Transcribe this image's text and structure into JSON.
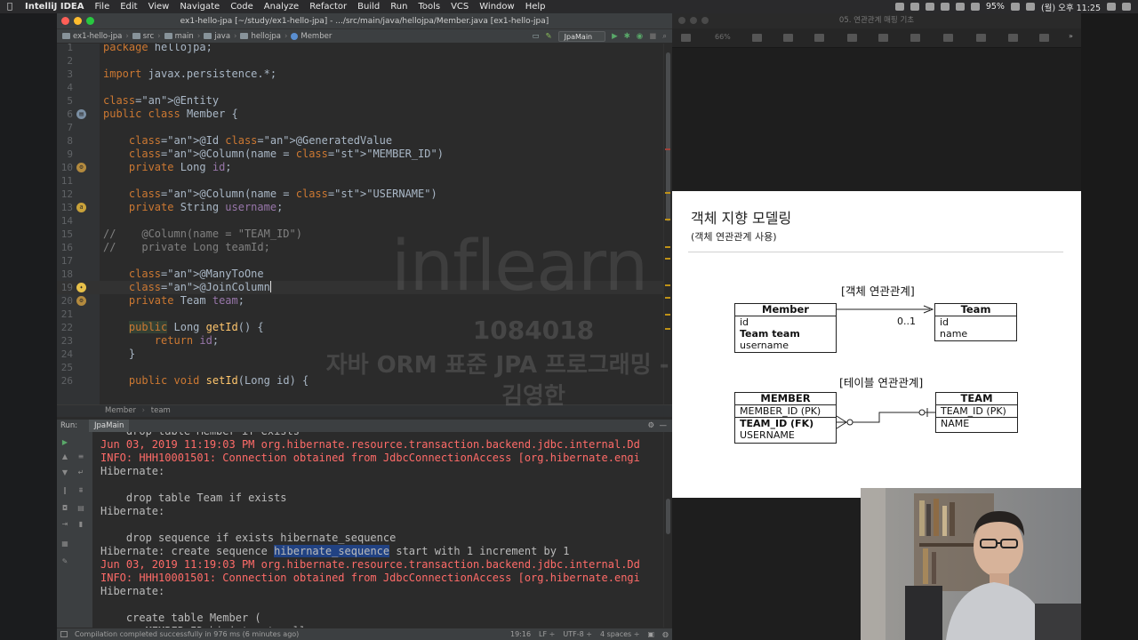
{
  "menubar": {
    "app_name": "IntelliJ IDEA",
    "menus": [
      "File",
      "Edit",
      "View",
      "Navigate",
      "Code",
      "Analyze",
      "Refactor",
      "Build",
      "Run",
      "Tools",
      "VCS",
      "Window",
      "Help"
    ],
    "battery": "95%",
    "clock": "(월) 오후 11:25"
  },
  "ide": {
    "window_title": "ex1-hello-jpa [~/study/ex1-hello-jpa] - .../src/main/java/hellojpa/Member.java [ex1-hello-jpa]",
    "breadcrumbs": [
      "ex1-hello-jpa",
      "src",
      "main",
      "java",
      "hellojpa",
      "Member"
    ],
    "run_config": "JpaMain",
    "code_lines": [
      {
        "n": "1",
        "text": "package hellojpa;"
      },
      {
        "n": "2",
        "text": ""
      },
      {
        "n": "3",
        "text": "import javax.persistence.*;"
      },
      {
        "n": "4",
        "text": ""
      },
      {
        "n": "5",
        "text": "@Entity"
      },
      {
        "n": "6",
        "text": "public class Member {"
      },
      {
        "n": "7",
        "text": ""
      },
      {
        "n": "8",
        "text": "    @Id @GeneratedValue"
      },
      {
        "n": "9",
        "text": "    @Column(name = \"MEMBER_ID\")"
      },
      {
        "n": "10",
        "text": "    private Long id;"
      },
      {
        "n": "11",
        "text": ""
      },
      {
        "n": "12",
        "text": "    @Column(name = \"USERNAME\")"
      },
      {
        "n": "13",
        "text": "    private String username;"
      },
      {
        "n": "14",
        "text": ""
      },
      {
        "n": "15",
        "text": "//    @Column(name = \"TEAM_ID\")"
      },
      {
        "n": "16",
        "text": "//    private Long teamId;"
      },
      {
        "n": "17",
        "text": ""
      },
      {
        "n": "18",
        "text": "    @ManyToOne"
      },
      {
        "n": "19",
        "text": "    @JoinColumn"
      },
      {
        "n": "20",
        "text": "    private Team team;"
      },
      {
        "n": "21",
        "text": ""
      },
      {
        "n": "22",
        "text": "    public Long getId() {"
      },
      {
        "n": "23",
        "text": "        return id;"
      },
      {
        "n": "24",
        "text": "    }"
      },
      {
        "n": "25",
        "text": ""
      },
      {
        "n": "26",
        "text": "    public void setId(Long id) {"
      }
    ],
    "editor_crumbs": [
      "Member",
      "team"
    ],
    "run_label": "Run:",
    "run_tab": "JpaMain",
    "console_lines": [
      {
        "cls": "",
        "text": "    drop table Member if exists"
      },
      {
        "cls": "err",
        "text": "Jun 03, 2019 11:19:03 PM org.hibernate.resource.transaction.backend.jdbc.internal.Dd"
      },
      {
        "cls": "err",
        "text": "INFO: HHH10001501: Connection obtained from JdbcConnectionAccess [org.hibernate.engi"
      },
      {
        "cls": "",
        "text": "Hibernate:"
      },
      {
        "cls": "",
        "text": ""
      },
      {
        "cls": "",
        "text": "    drop table Team if exists"
      },
      {
        "cls": "",
        "text": "Hibernate:"
      },
      {
        "cls": "",
        "text": ""
      },
      {
        "cls": "",
        "text": "    drop sequence if exists hibernate_sequence"
      },
      {
        "cls": "",
        "text": "Hibernate: create sequence hibernate_sequence start with 1 increment by 1"
      },
      {
        "cls": "err",
        "text": "Jun 03, 2019 11:19:03 PM org.hibernate.resource.transaction.backend.jdbc.internal.Dd"
      },
      {
        "cls": "err",
        "text": "INFO: HHH10001501: Connection obtained from JdbcConnectionAccess [org.hibernate.engi"
      },
      {
        "cls": "",
        "text": "Hibernate:"
      },
      {
        "cls": "",
        "text": ""
      },
      {
        "cls": "",
        "text": "    create table Member ("
      },
      {
        "cls": "",
        "text": "       MEMBER_ID bigint not null,"
      }
    ],
    "status": {
      "message": "Compilation completed successfully in 976 ms (6 minutes ago)",
      "position": "19:16",
      "line_sep": "LF ÷",
      "encoding": "UTF-8 ÷",
      "indent": "4 spaces ÷"
    }
  },
  "watermark": {
    "logo": "inflearn",
    "id": "1084018",
    "course": "자바 ORM 표준 JPA 프로그래밍 - 기본편",
    "author": "김영한"
  },
  "keynote": {
    "window_title": "05. 연관관계 매핑 기초",
    "zoom": "66%",
    "slide": {
      "title": "객체 지향 모델링",
      "subtitle": "(객체 연관관계 사용)",
      "object_section": "[객체 연관관계]",
      "member_obj": {
        "header": "Member",
        "rows": [
          "id",
          "Team team",
          "username"
        ]
      },
      "team_obj": {
        "header": "Team",
        "rows": [
          "id",
          "name"
        ]
      },
      "multiplicity": "0..1",
      "table_section": "[테이블 연관관계]",
      "member_tbl": {
        "header": "MEMBER",
        "pk": "MEMBER_ID (PK)",
        "fk": "TEAM_ID (FK)",
        "col": "USERNAME"
      },
      "team_tbl": {
        "header": "TEAM",
        "pk": "TEAM_ID (PK)",
        "col": "NAME"
      }
    }
  }
}
